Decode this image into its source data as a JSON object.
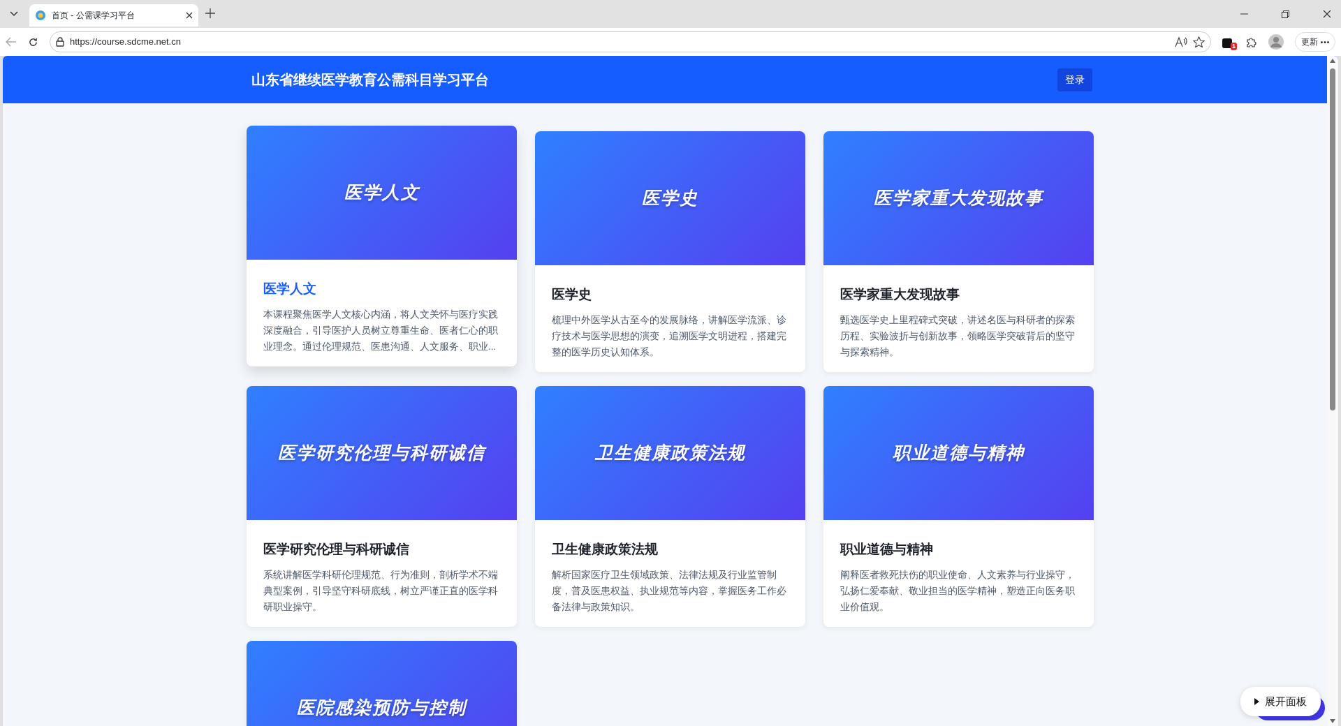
{
  "browser": {
    "tab_title": "首页 - 公需课学习平台",
    "url": "https://course.sdcme.net.cn",
    "extension_badge": "1",
    "update_button": "更新"
  },
  "header": {
    "title": "山东省继续医学教育公需科目学习平台",
    "login_button": "登录"
  },
  "courses": [
    {
      "banner": "医学人文",
      "title": "医学人文",
      "description": "本课程聚焦医学人文核心内涵，将人文关怀与医疗实践深度融合，引导医护人员树立尊重生命、医者仁心的职业理念。通过伦理规范、医患沟通、人文服务、职业...",
      "hovered": true
    },
    {
      "banner": "医学史",
      "title": "医学史",
      "description": "梳理中外医学从古至今的发展脉络，讲解医学流派、诊疗技术与医学思想的演变，追溯医学文明进程，搭建完整的医学历史认知体系。",
      "hovered": false
    },
    {
      "banner": "医学家重大发现故事",
      "title": "医学家重大发现故事",
      "description": "甄选医学史上里程碑式突破，讲述名医与科研者的探索历程、实验波折与创新故事，领略医学突破背后的坚守与探索精神。",
      "hovered": false
    },
    {
      "banner": "医学研究伦理与科研诚信",
      "title": "医学研究伦理与科研诚信",
      "description": "系统讲解医学科研伦理规范、行为准则，剖析学术不端典型案例，引导坚守科研底线，树立严谨正直的医学科研职业操守。",
      "hovered": false
    },
    {
      "banner": "卫生健康政策法规",
      "title": "卫生健康政策法规",
      "description": "解析国家医疗卫生领域政策、法律法规及行业监管制度，普及医患权益、执业规范等内容，掌握医务工作必备法律与政策知识。",
      "hovered": false
    },
    {
      "banner": "职业道德与精神",
      "title": "职业道德与精神",
      "description": "阐释医者救死扶伤的职业使命、人文素养与行业操守，弘扬仁爱奉献、敬业担当的医学精神，塑造正向医务职业价值观。",
      "hovered": false
    },
    {
      "banner": "医院感染预防与控制",
      "hovered": false
    }
  ],
  "panel_button": {
    "label": "展开面板"
  }
}
